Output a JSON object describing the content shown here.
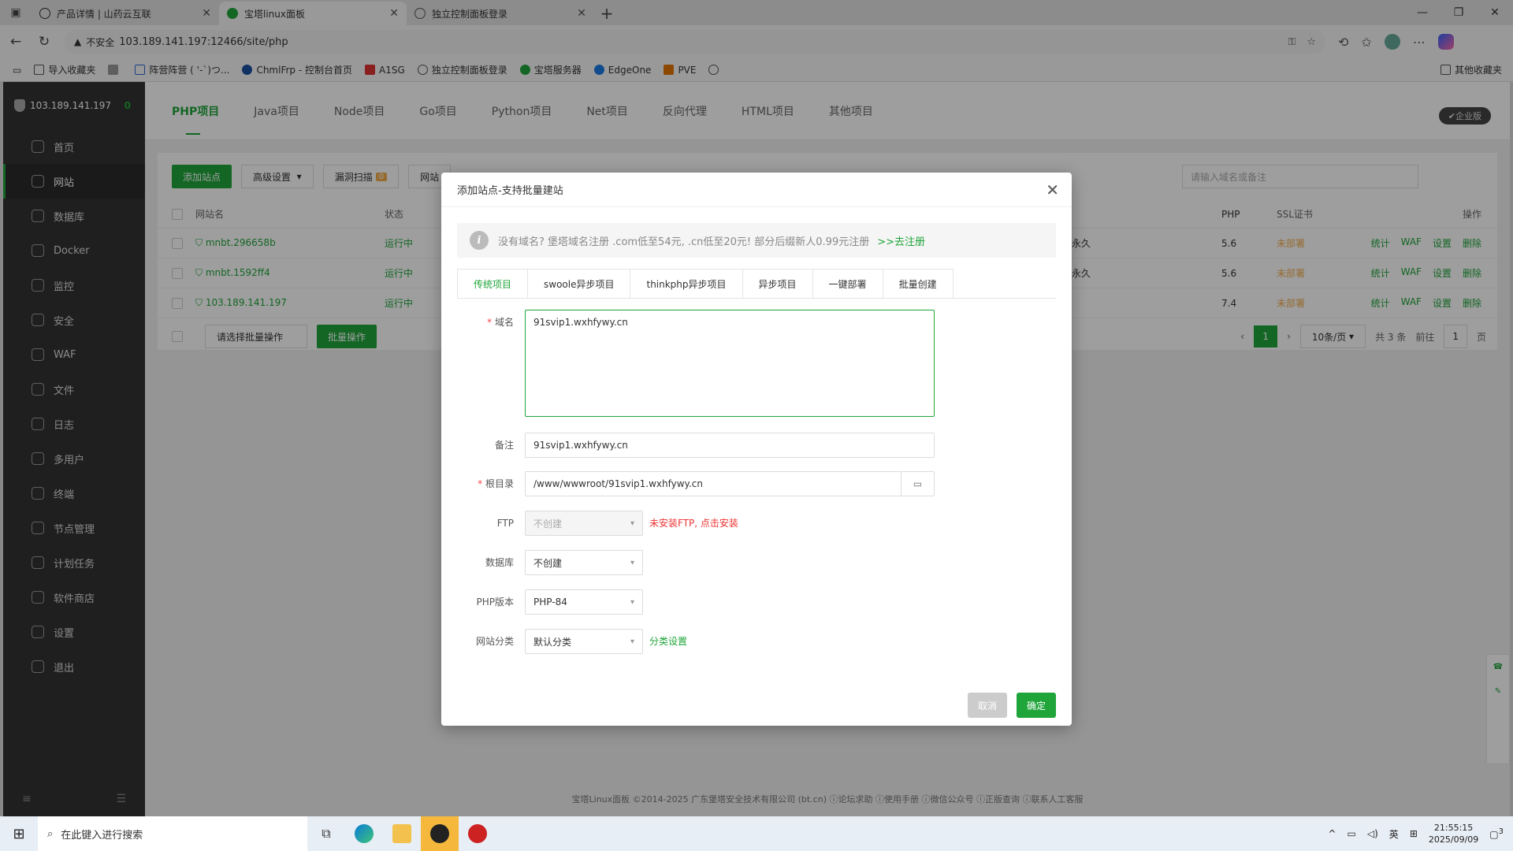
{
  "browser": {
    "tabs": [
      {
        "title": "产品详情 | 山药云互联",
        "active": false,
        "fav_color": "#333333"
      },
      {
        "title": "宝塔linux面板",
        "active": true,
        "fav_color": "#20a53a"
      },
      {
        "title": "独立控制面板登录",
        "active": false,
        "fav_color": "#555555"
      }
    ],
    "security_label": "不安全",
    "url": "103.189.141.197:12466/site/php",
    "bookmarks": [
      "导入收藏夹",
      "",
      "阵营阵营 ( '-`)つ...",
      "ChmlFrp - 控制台首页",
      "A1SG",
      "独立控制面板登录",
      "宝塔服务器",
      "EdgeOne",
      "PVE",
      ""
    ],
    "bookmarks_right": "其他收藏夹"
  },
  "sidebar": {
    "server_ip": "103.189.141.197",
    "count": "0",
    "items": [
      "首页",
      "网站",
      "数据库",
      "Docker",
      "监控",
      "安全",
      "WAF",
      "文件",
      "日志",
      "多用户",
      "终端",
      "节点管理",
      "计划任务",
      "软件商店",
      "设置",
      "退出"
    ]
  },
  "project_tabs": [
    "PHP项目",
    "Java项目",
    "Node项目",
    "Go项目",
    "Python项目",
    "Net项目",
    "反向代理",
    "HTML项目",
    "其他项目"
  ],
  "enterprise_label": "企业版",
  "toolbar": {
    "add_site": "添加站点",
    "advanced": "高级设置",
    "scan": "漏洞扫描",
    "scan_count": "0",
    "site_btn": "网站",
    "search_placeholder": "请输入域名或备注"
  },
  "table": {
    "headers": {
      "name": "网站名",
      "status": "状态",
      "php": "PHP",
      "ssl": "SSL证书",
      "ops": "操作"
    },
    "rows": [
      {
        "name": "mnbt.296658b",
        "status": "运行中",
        "expire": "永久",
        "php": "5.6",
        "ssl": "未部署"
      },
      {
        "name": "mnbt.1592ff4",
        "status": "运行中",
        "expire": "永久",
        "php": "5.6",
        "ssl": "未部署"
      },
      {
        "name": "103.189.141.197",
        "status": "运行中",
        "expire": "",
        "php": "7.4",
        "ssl": "未部署"
      }
    ],
    "ops": [
      "统计",
      "WAF",
      "设置",
      "删除"
    ],
    "batch_select": "请选择批量操作",
    "batch_btn": "批量操作"
  },
  "pager": {
    "current": "1",
    "per_page": "10条/页",
    "total": "共 3 条",
    "goto": "前往",
    "page_input": "1",
    "page_unit": "页"
  },
  "copyright": "宝塔Linux面板 ©2014-2025 广东堡塔安全技术有限公司 (bt.cn)  ⓘ论坛求助  ⓘ使用手册  ⓘ微信公众号  ⓘ正版查询  ⓘ联系人工客服",
  "modal": {
    "title": "添加站点-支持批量建站",
    "notice": "没有域名? 堡塔域名注册 .com低至54元, .cn低至20元! 部分后缀新人0.99元注册",
    "notice_link": ">>去注册",
    "tabs": [
      "传统项目",
      "swoole异步项目",
      "thinkphp异步项目",
      "异步项目",
      "一键部署",
      "批量创建"
    ],
    "domain_label": "域名",
    "domain_value": "91svip1.wxhfywy.cn",
    "remark_label": "备注",
    "remark_value": "91svip1.wxhfywy.cn",
    "root_label": "根目录",
    "root_value": "/www/wwwroot/91svip1.wxhfywy.cn",
    "ftp_label": "FTP",
    "ftp_value": "不创建",
    "ftp_tip": "未安装FTP, 点击安装",
    "db_label": "数据库",
    "db_value": "不创建",
    "php_label": "PHP版本",
    "php_value": "PHP-84",
    "category_label": "网站分类",
    "category_value": "默认分类",
    "category_link": "分类设置",
    "cancel": "取消",
    "confirm": "确定"
  },
  "taskbar": {
    "search_placeholder": "在此键入进行搜索",
    "lang": "英",
    "time": "21:55:15",
    "date": "2025/09/09",
    "notif": "3"
  },
  "colors": {
    "accent": "#20a53a",
    "sidebar": "#333333",
    "warning": "#f0ad4e",
    "danger": "#ee3333"
  }
}
